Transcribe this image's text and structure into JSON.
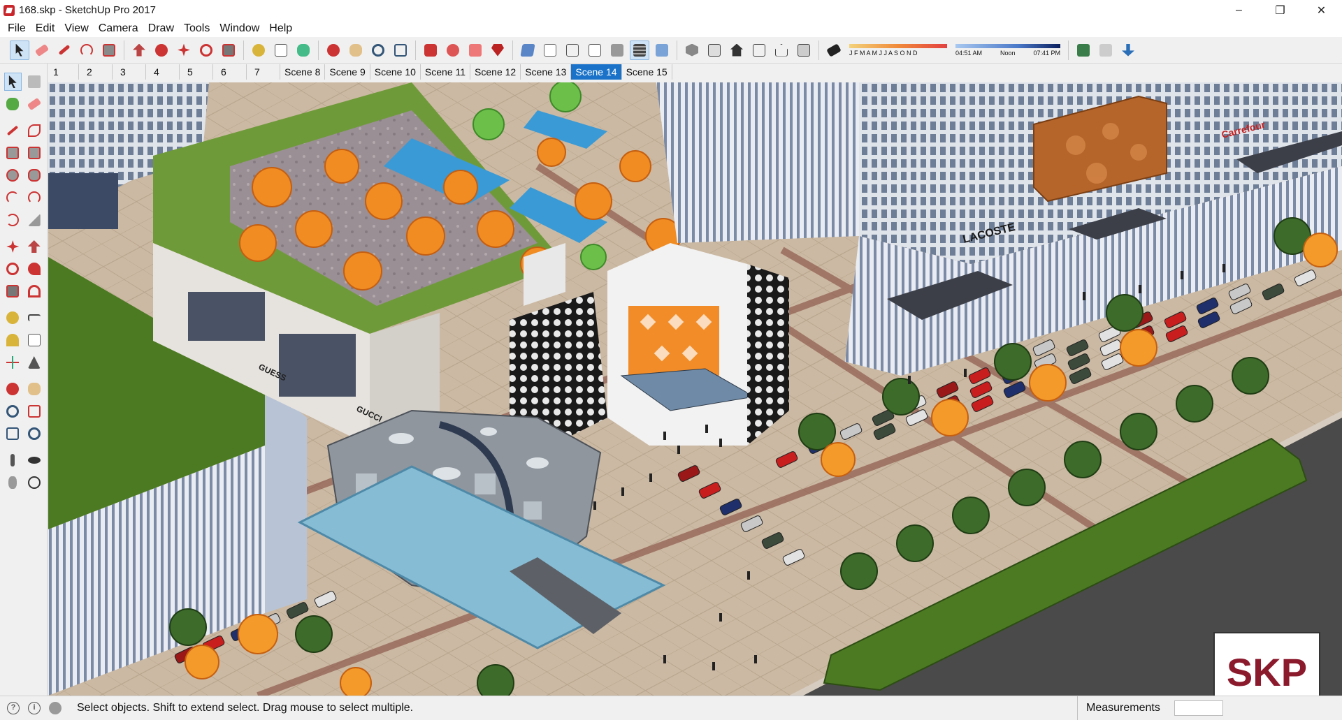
{
  "window": {
    "title": "168.skp - SketchUp Pro 2017",
    "controls": [
      "minimize-icon",
      "restore-icon",
      "close-icon"
    ]
  },
  "menu": [
    "File",
    "Edit",
    "View",
    "Camera",
    "Draw",
    "Tools",
    "Window",
    "Help"
  ],
  "toolbar": {
    "shadow_months": "J F M A M J J A S O N D",
    "time_start": "04:51 AM",
    "time_noon": "Noon",
    "time_end": "07:41 PM"
  },
  "scenes": [
    {
      "label": "1",
      "selected": false
    },
    {
      "label": "2",
      "selected": false
    },
    {
      "label": "3",
      "selected": false
    },
    {
      "label": "4",
      "selected": false
    },
    {
      "label": "5",
      "selected": false
    },
    {
      "label": "6",
      "selected": false
    },
    {
      "label": "7",
      "selected": false
    },
    {
      "label": "Scene 8",
      "selected": false
    },
    {
      "label": "Scene 9",
      "selected": false
    },
    {
      "label": "Scene 10",
      "selected": false
    },
    {
      "label": "Scene 11",
      "selected": false
    },
    {
      "label": "Scene 12",
      "selected": false
    },
    {
      "label": "Scene 13",
      "selected": false
    },
    {
      "label": "Scene 14",
      "selected": true
    },
    {
      "label": "Scene 15",
      "selected": false
    }
  ],
  "status": {
    "message": "Select objects. Shift to extend select. Drag mouse to select multiple.",
    "measurements_label": "Measurements",
    "measurements_value": ""
  },
  "viewport": {
    "signs": [
      "LACOSTE",
      "Carrefour",
      "GUCCI",
      "GUESS",
      "SKP"
    ]
  },
  "watermark": "SKP",
  "colors": {
    "accent": "#1a73c8",
    "watermark": "#8b1a2d"
  }
}
